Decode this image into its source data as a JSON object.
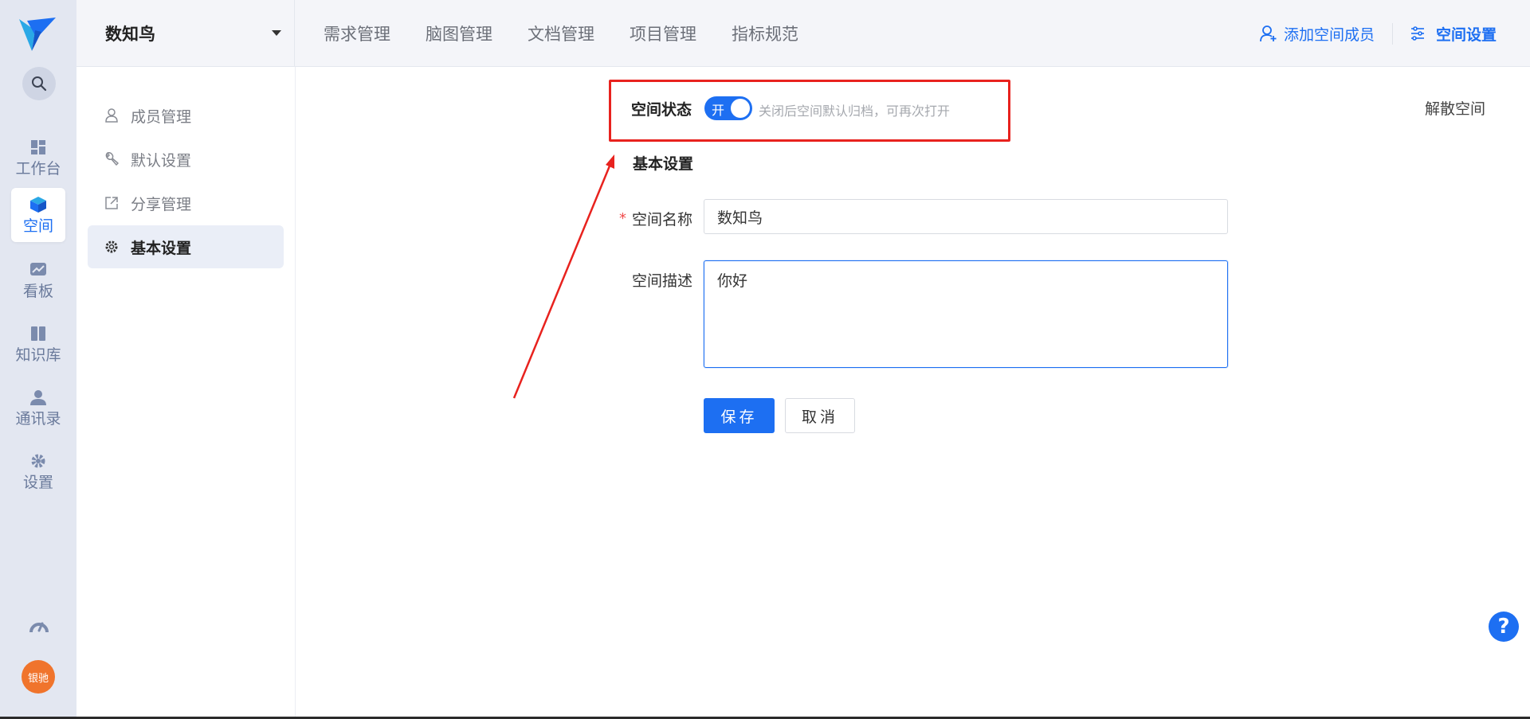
{
  "rail": {
    "items": [
      {
        "label": "工作台",
        "icon": "dashboard-icon"
      },
      {
        "label": "空间",
        "icon": "cube-icon"
      },
      {
        "label": "看板",
        "icon": "chart-board-icon"
      },
      {
        "label": "知识库",
        "icon": "book-icon"
      },
      {
        "label": "通讯录",
        "icon": "contacts-icon"
      },
      {
        "label": "设置",
        "icon": "gear-icon"
      }
    ],
    "avatar_text": "银驰"
  },
  "topbar": {
    "space_name": "数知鸟",
    "nav": [
      "需求管理",
      "脑图管理",
      "文档管理",
      "项目管理",
      "指标规范"
    ],
    "add_member_label": "添加空间成员",
    "settings_label": "空间设置"
  },
  "subnav": {
    "items": [
      {
        "label": "成员管理",
        "icon": "user-icon"
      },
      {
        "label": "默认设置",
        "icon": "wrench-icon"
      },
      {
        "label": "分享管理",
        "icon": "share-icon"
      },
      {
        "label": "基本设置",
        "icon": "gear-icon"
      }
    ],
    "active": "基本设置"
  },
  "main": {
    "status_label": "空间状态",
    "toggle_text": "开",
    "toggle_on": true,
    "status_hint": "关闭后空间默认归档，可再次打开",
    "dissolve_label": "解散空间",
    "section_title": "基本设置",
    "name_label": "空间名称",
    "required_mark": "*",
    "name_value": "数知鸟",
    "desc_label": "空间描述",
    "desc_value": "你好",
    "save_label": "保存",
    "cancel_label": "取消"
  },
  "help_label": "?",
  "colors": {
    "accent": "#1d6ff2",
    "annotation": "#e8221e",
    "rail_bg": "#e3e7f1",
    "avatar": "#f0742c"
  }
}
